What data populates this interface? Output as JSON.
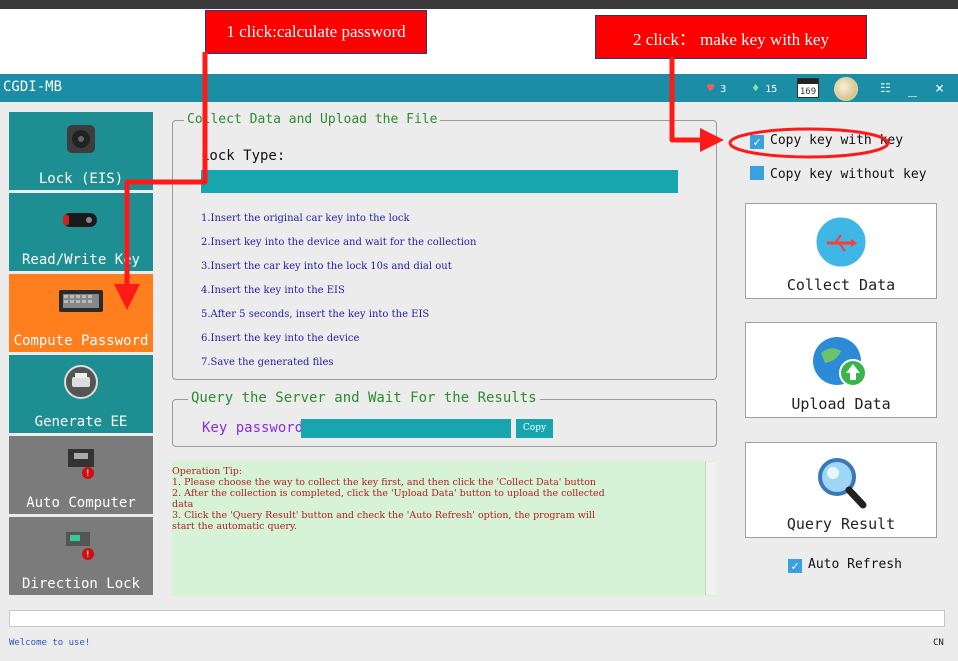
{
  "callouts": {
    "first": "1 click:calculate password",
    "second": "2 click： make key with key"
  },
  "window": {
    "title": "CGDI-MB",
    "hearts": "3",
    "gems": "15",
    "calendar": "169",
    "minimize": "_",
    "close": "×"
  },
  "sidebar": [
    {
      "label": "Lock (EIS)",
      "icon": "lock-ignition-icon"
    },
    {
      "label": "Read/Write Key",
      "icon": "car-key-icon"
    },
    {
      "label": "Compute Password",
      "icon": "keyboard-icon"
    },
    {
      "label": "Generate EE",
      "icon": "printer-icon"
    },
    {
      "label": "Auto Computer",
      "icon": "ecu-module-icon"
    },
    {
      "label": "Direction Lock",
      "icon": "steering-lock-icon"
    }
  ],
  "collect": {
    "legend": "Collect Data and Upload the File",
    "lock_type_label": "Lock Type:",
    "steps": [
      "1.Insert  the  original  car  key  into  the  lock",
      "2.Insert  key  into  the  device  and  wait  for  the  collection",
      "3.Insert  the  car  key  into  the  lock  10s  and  dial  out",
      "4.Insert  the  key  into  the  EIS",
      "5.After  5  seconds,  insert  the  key  into  the  EIS",
      "6.Insert  the  key  into  the  device",
      "7.Save  the  generated  files"
    ]
  },
  "query": {
    "legend": "Query the Server and Wait For the Results",
    "key_password_label": "Key password",
    "copy_label": "Copy"
  },
  "tips": [
    "Operation Tip:",
    "1.  Please choose the way to collect the key first, and then click the 'Collect Data' button",
    "2.  After the collection is completed, click the 'Upload Data' button to upload the collected",
    "     data",
    "3.  Click the 'Query Result' button and check the 'Auto Refresh' option, the program will",
    "     start the automatic query."
  ],
  "options": {
    "copy_with_key": "Copy key with key",
    "copy_without_key": "Copy key without key",
    "auto_refresh": "Auto Refresh"
  },
  "actions": {
    "collect": "Collect Data",
    "upload": "Upload  Data",
    "query": "Query Result"
  },
  "status": {
    "welcome": "Welcome to use!",
    "lang": "CN"
  },
  "colors": {
    "titlebar": "#1b8ea5",
    "nav_teal": "#1d8e91",
    "nav_gray": "#7b7b7b",
    "nav_active": "#ff7f1f",
    "annotation_red": "#ff0000"
  }
}
